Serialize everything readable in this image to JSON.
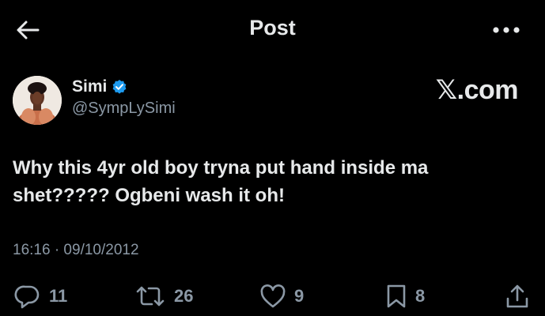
{
  "header": {
    "title": "Post",
    "back_icon": "arrow-left-icon",
    "more_icon": "more-horizontal-icon"
  },
  "author": {
    "name": "Simi",
    "handle": "@SympLySimi",
    "verified_icon": "verified-badge-icon",
    "verified_color": "#1d9bf0"
  },
  "watermark": {
    "text": "𝕏.com"
  },
  "post": {
    "text": "Why this 4yr old boy tryna put hand inside ma shet????? Ogbeni wash it oh!",
    "timestamp": "16:16 · 09/10/2012"
  },
  "actions": {
    "reply_count": "11",
    "repost_count": "26",
    "like_count": "9",
    "bookmark_count": "8",
    "reply_icon": "reply-icon",
    "repost_icon": "repost-icon",
    "like_icon": "heart-icon",
    "bookmark_icon": "bookmark-icon",
    "share_icon": "share-icon"
  },
  "colors": {
    "background": "#000000",
    "text_primary": "#e7e9ea",
    "text_secondary": "#8b98a5"
  }
}
